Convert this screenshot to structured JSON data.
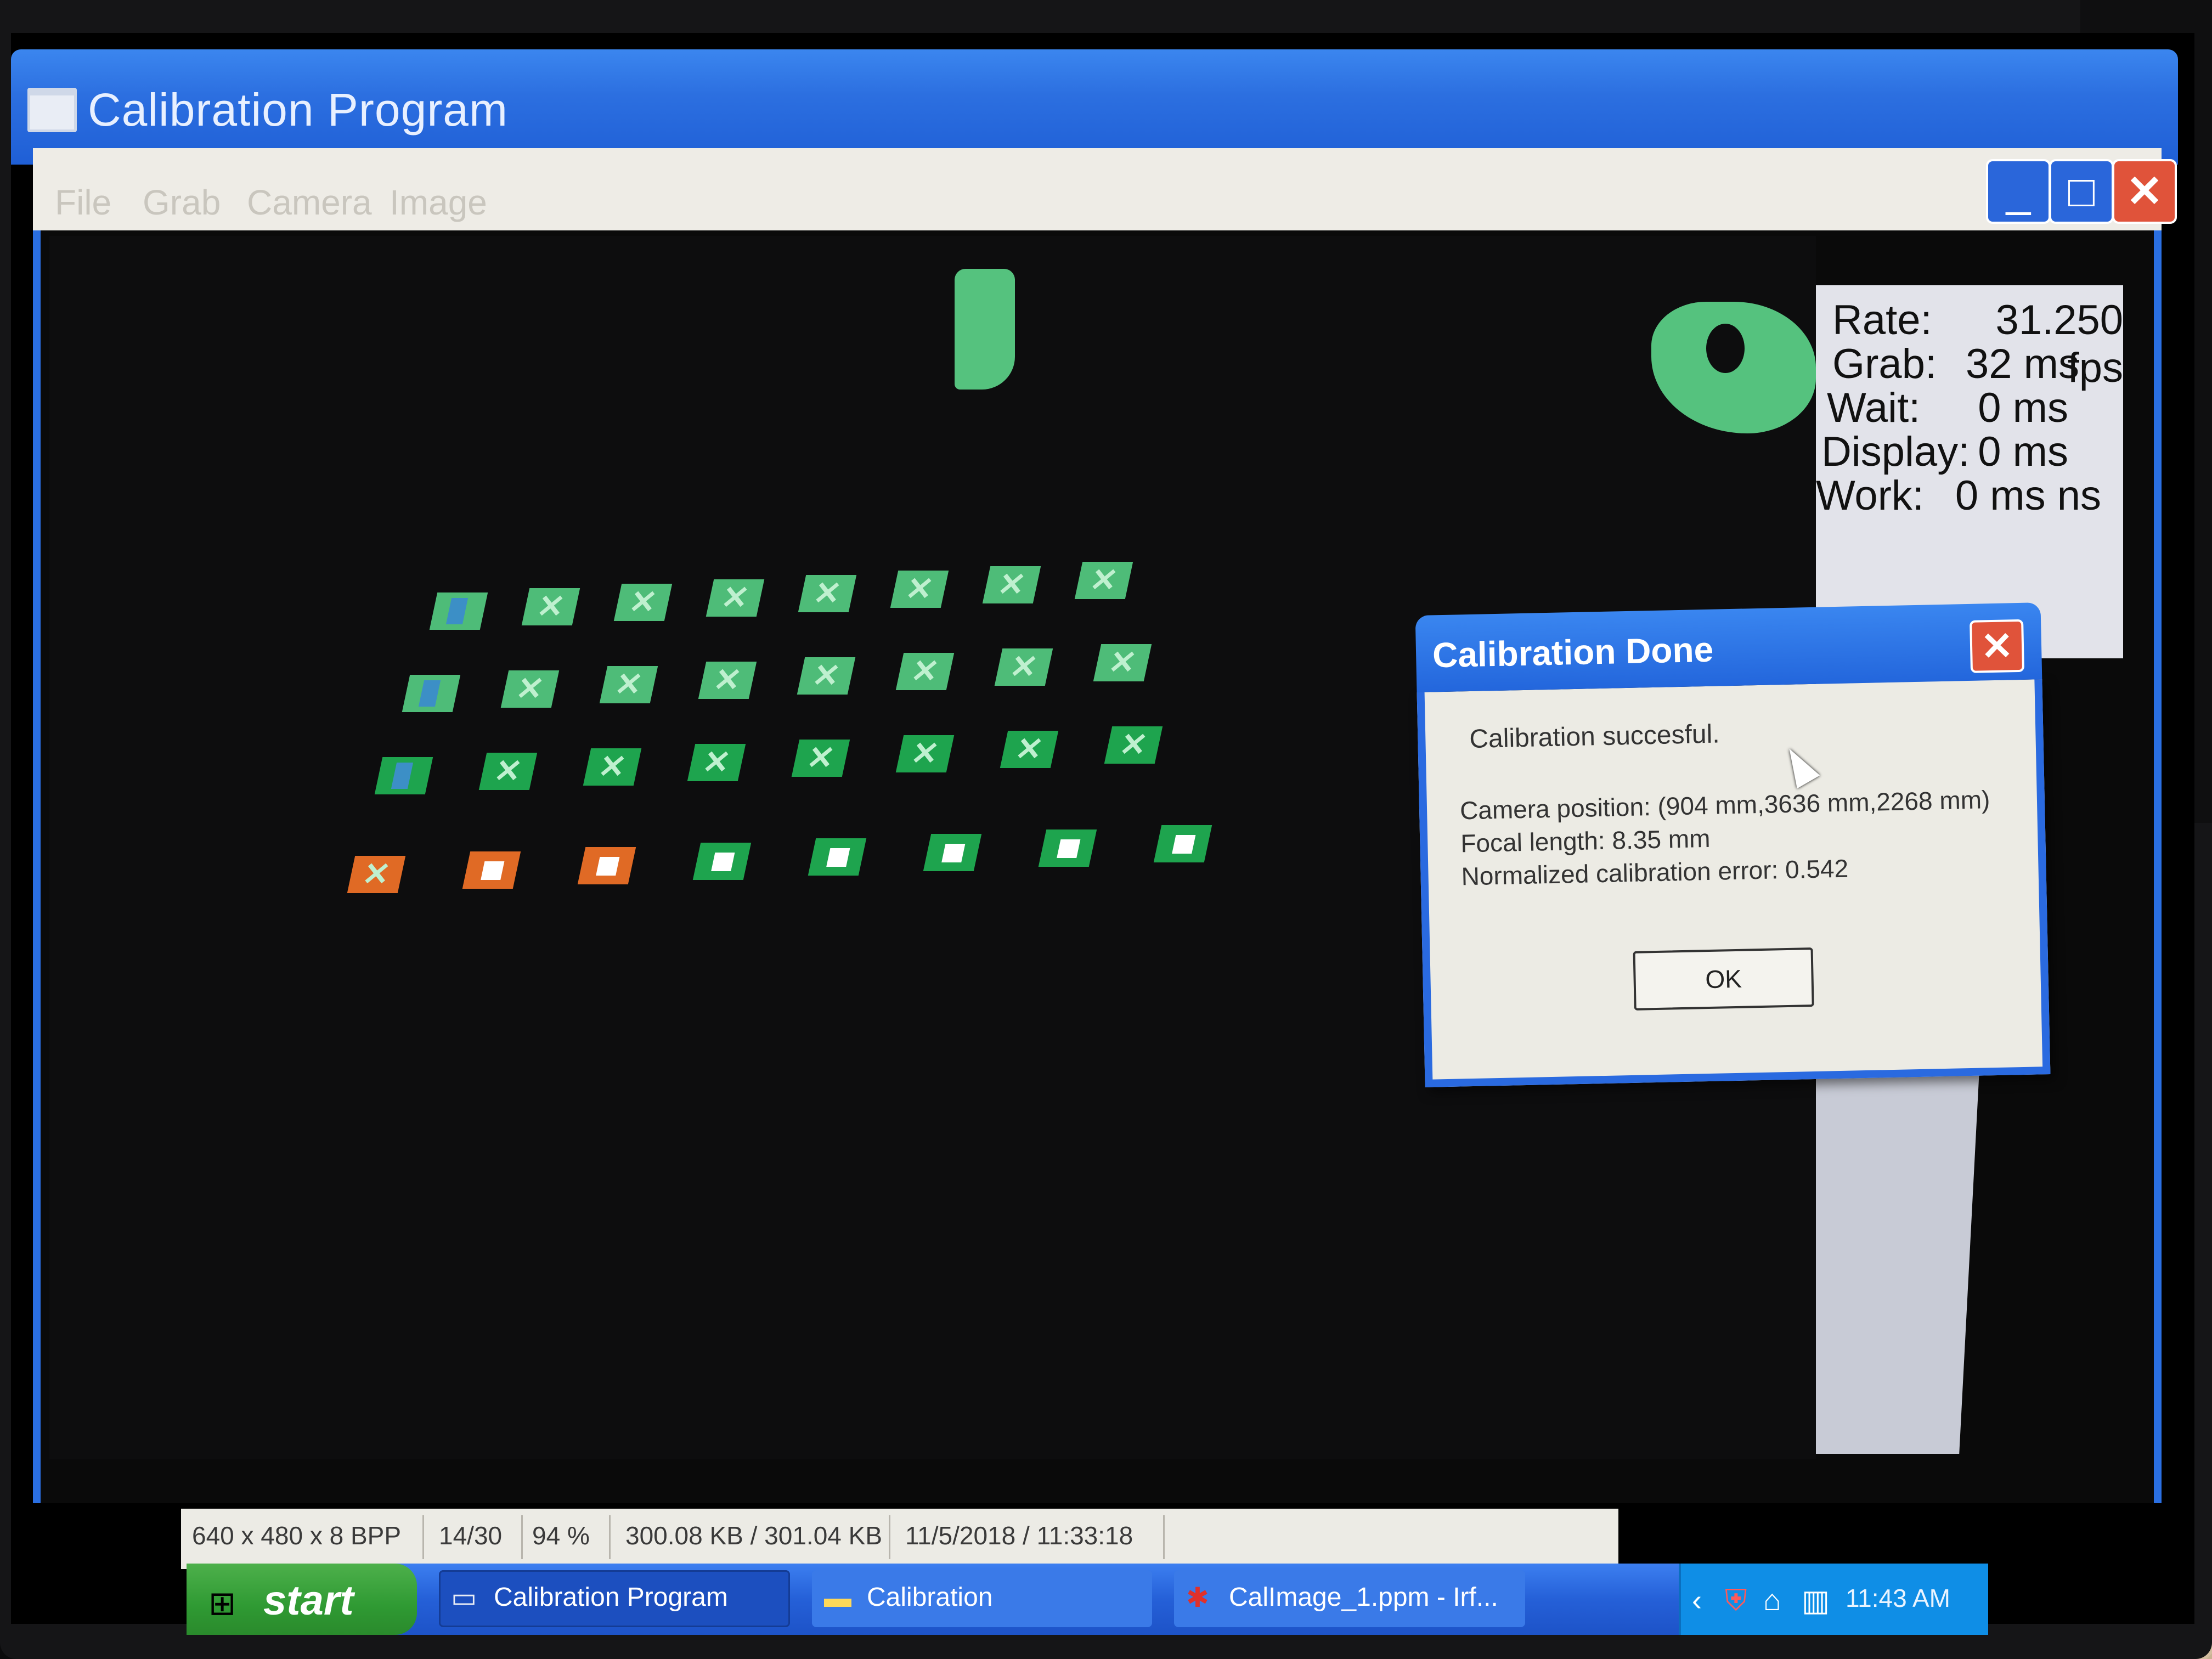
{
  "window": {
    "title": "Calibration Program",
    "controls": {
      "minimize": "_",
      "maximize": "□",
      "close": "✕"
    }
  },
  "menu": [
    "File",
    "Grab",
    "Camera",
    "Image"
  ],
  "stats": [
    {
      "label": "Rate:",
      "value": "31.250 fps"
    },
    {
      "label": "Grab:",
      "value": "32 ms"
    },
    {
      "label": "Wait:",
      "value": "0 ms"
    },
    {
      "label": "Display:",
      "value": "0 ms"
    },
    {
      "label": "Work:",
      "value": "0 ms ns"
    }
  ],
  "statusbar": {
    "resolution": "640 x 480 x 8 BPP",
    "frame": "14/30",
    "zoom": "94 %",
    "size": "300.08 KB / 301.04 KB",
    "datetime": "11/5/2018 / 11:33:18"
  },
  "dialog": {
    "title": "Calibration Done",
    "close": "✕",
    "message": "Calibration succesful.",
    "camera_position": "Camera position: (904 mm,3636 mm,2268 mm)",
    "focal_length": "Focal length: 8.35 mm",
    "error": "Normalized calibration error: 0.542",
    "ok": "OK"
  },
  "taskbar": {
    "start": "start",
    "tasks": [
      {
        "label": "Calibration Program",
        "icon": "window-icon"
      },
      {
        "label": "Calibration",
        "icon": "folder-icon"
      },
      {
        "label": "CalImage_1.ppm - Irf...",
        "icon": "irfanview-icon"
      }
    ],
    "clock": "11:43 AM"
  },
  "colors": {
    "titlebar": "#2c6fe0",
    "marker_green": "#4ebc78",
    "marker_dark_green": "#1ea44e",
    "marker_orange": "#e06a25",
    "start_green": "#2f9a33"
  }
}
